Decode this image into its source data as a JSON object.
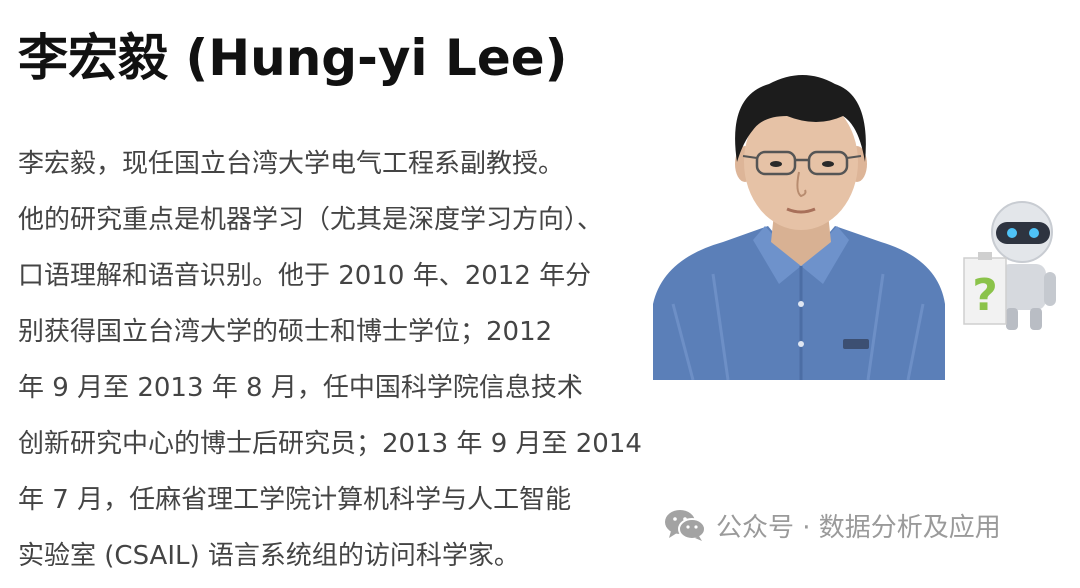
{
  "heading": {
    "title": "李宏毅 (Hung-yi Lee)"
  },
  "bio": {
    "lines": [
      "李宏毅，现任国立台湾大学电气工程系副教授。",
      "他的研究重点是机器学习（尤其是深度学习方向）、",
      "口语理解和语音识别。他于 2010 年、2012 年分",
      "别获得国立台湾大学的硕士和博士学位；2012",
      "年 9 月至 2013 年 8 月，任中国科学院信息技术",
      "创新研究中心的博士后研究员；2013 年 9 月至 2014",
      "年 7 月，任麻省理工学院计算机科学与人工智能",
      "实验室 (CSAIL) 语言系统组的访问科学家。"
    ]
  },
  "images": {
    "portrait": "portrait-photo",
    "robot": "robot-question-mark-icon"
  },
  "watermark": {
    "icon": "wechat-icon",
    "text": "公众号 · 数据分析及应用"
  },
  "colors": {
    "title": "#111111",
    "body_text": "#444444",
    "watermark": "#9a9a9a",
    "shirt": "#5b7fb8",
    "robot_accent": "#8bc34a"
  }
}
